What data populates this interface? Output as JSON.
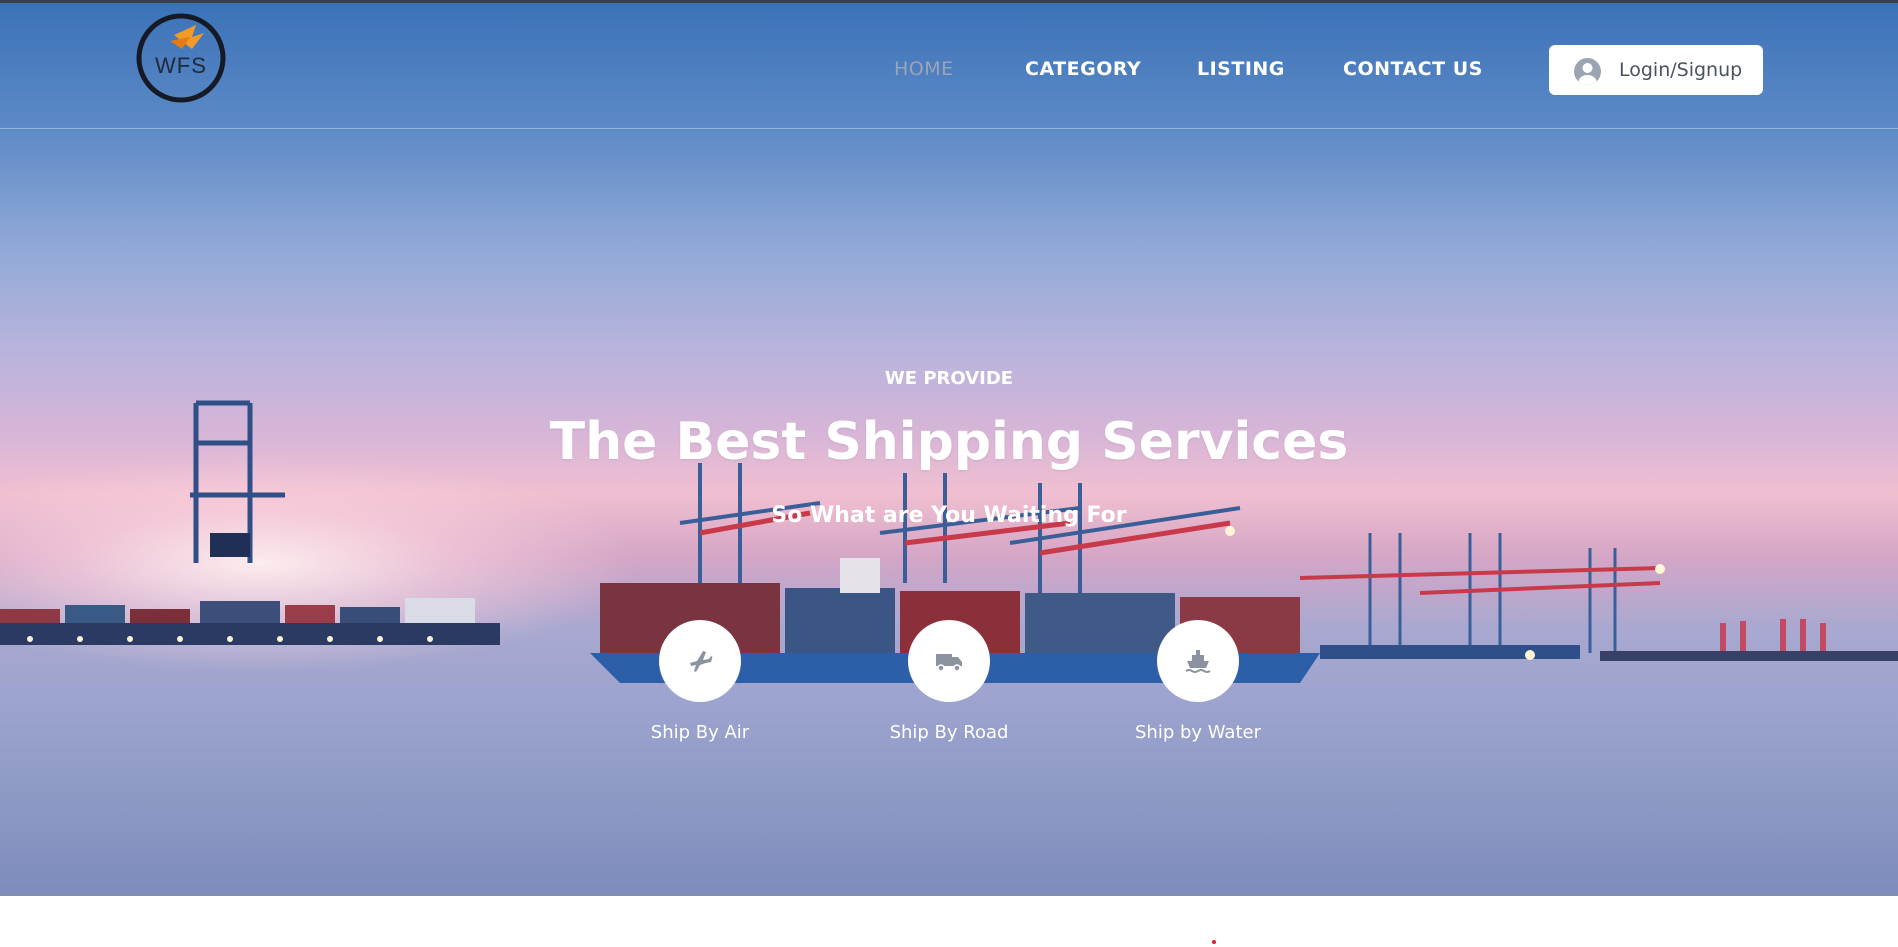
{
  "brand": {
    "logo_text": "WFS",
    "accent": "#f19a27"
  },
  "nav": {
    "items": [
      {
        "label": "HOME",
        "active": true
      },
      {
        "label": "CATEGORY",
        "active": false
      },
      {
        "label": "LISTING",
        "active": false
      },
      {
        "label": "CONTACT US",
        "active": false
      }
    ],
    "login_label": "Login/Signup",
    "login_icon": "user-avatar-icon"
  },
  "hero": {
    "eyebrow": "WE PROVIDE",
    "title": "The Best Shipping Services",
    "subtitle": "So What are You Waiting For",
    "services": [
      {
        "label": "Ship By Air",
        "icon": "airplane-icon"
      },
      {
        "label": "Ship By Road",
        "icon": "truck-icon"
      },
      {
        "label": "Ship by Water",
        "icon": "ship-icon"
      }
    ]
  },
  "colors": {
    "header_sky": "#3b72b8",
    "nav_text": "#ffffff",
    "nav_active": "#9aa4b8",
    "icon_gray": "#8c93a0"
  }
}
